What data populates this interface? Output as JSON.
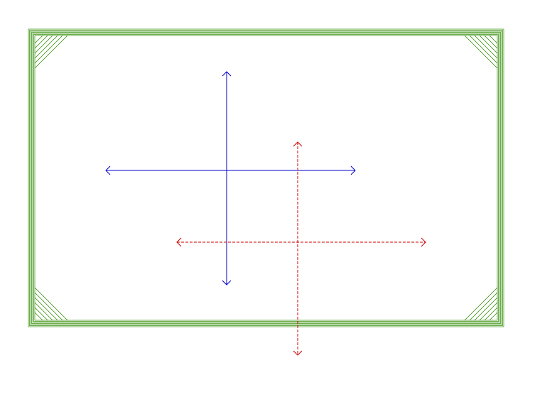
{
  "colors": {
    "background": "#ffffff",
    "frame": "#2e8b00",
    "solid_cross": "#0000cc",
    "dashed_cross": "#cc0000"
  },
  "frame": {
    "line_count": 7,
    "corner_hatch_lines": 6,
    "style": "solid"
  },
  "crosses": [
    {
      "name": "solid-cross",
      "line_style": "solid",
      "color_key": "solid_cross",
      "arrowheads": "open"
    },
    {
      "name": "dashed-cross",
      "line_style": "dashed",
      "color_key": "dashed_cross",
      "arrowheads": "open"
    }
  ]
}
